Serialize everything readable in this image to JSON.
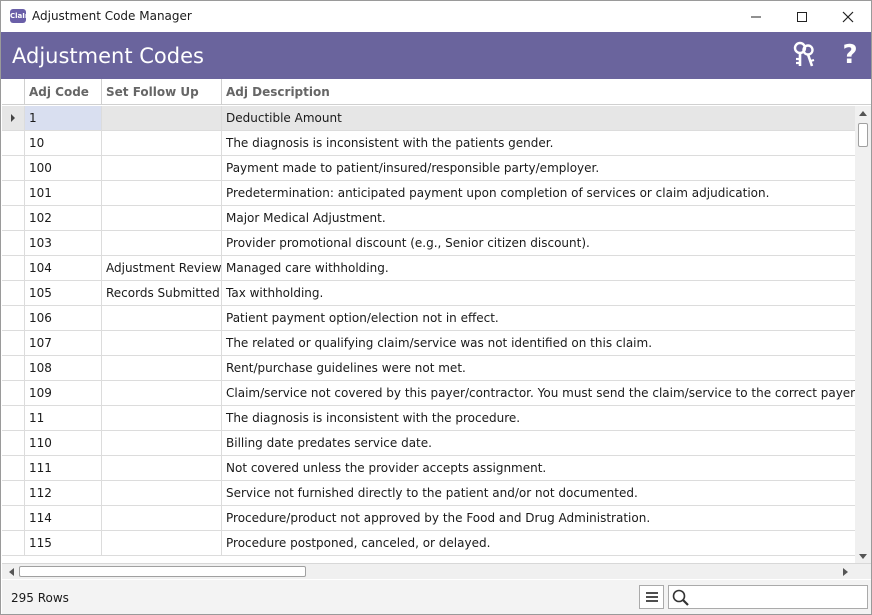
{
  "window": {
    "title": "Adjustment Code Manager",
    "app_icon_text": "ClaIm"
  },
  "header": {
    "title": "Adjustment Codes",
    "color": "#6a649d",
    "icons": [
      "keys-icon",
      "help-icon"
    ],
    "help_glyph": "?"
  },
  "grid": {
    "columns": [
      "Adj Code",
      "Set Follow Up",
      "Adj Description"
    ],
    "selected_row": 0,
    "rows": [
      {
        "code": "1",
        "follow_up": "",
        "description": "Deductible Amount"
      },
      {
        "code": "10",
        "follow_up": "",
        "description": "The diagnosis is inconsistent with the patients gender."
      },
      {
        "code": "100",
        "follow_up": "",
        "description": "Payment made to patient/insured/responsible party/employer."
      },
      {
        "code": "101",
        "follow_up": "",
        "description": "Predetermination: anticipated payment upon completion of services or claim adjudication."
      },
      {
        "code": "102",
        "follow_up": "",
        "description": "Major Medical Adjustment."
      },
      {
        "code": "103",
        "follow_up": "",
        "description": "Provider promotional discount (e.g., Senior citizen discount)."
      },
      {
        "code": "104",
        "follow_up": "Adjustment Review",
        "description": "Managed care withholding."
      },
      {
        "code": "105",
        "follow_up": "Records Submitted",
        "description": "Tax withholding."
      },
      {
        "code": "106",
        "follow_up": "",
        "description": "Patient payment option/election not in effect."
      },
      {
        "code": "107",
        "follow_up": "",
        "description": "The related or qualifying claim/service was not identified on this claim."
      },
      {
        "code": "108",
        "follow_up": "",
        "description": "Rent/purchase guidelines were not met."
      },
      {
        "code": "109",
        "follow_up": "",
        "description": "Claim/service not covered by this payer/contractor. You must send the claim/service to the correct payer/co"
      },
      {
        "code": "11",
        "follow_up": "",
        "description": "The diagnosis is inconsistent with the procedure."
      },
      {
        "code": "110",
        "follow_up": "",
        "description": "Billing date predates service date."
      },
      {
        "code": "111",
        "follow_up": "",
        "description": "Not covered unless the provider accepts assignment."
      },
      {
        "code": "112",
        "follow_up": "",
        "description": "Service not furnished directly to the patient and/or not documented."
      },
      {
        "code": "114",
        "follow_up": "",
        "description": "Procedure/product not approved by the Food and Drug Administration."
      },
      {
        "code": "115",
        "follow_up": "",
        "description": "Procedure postponed, canceled, or delayed."
      }
    ]
  },
  "status": {
    "row_count": "295 Rows"
  },
  "search": {
    "value": "",
    "placeholder": ""
  }
}
